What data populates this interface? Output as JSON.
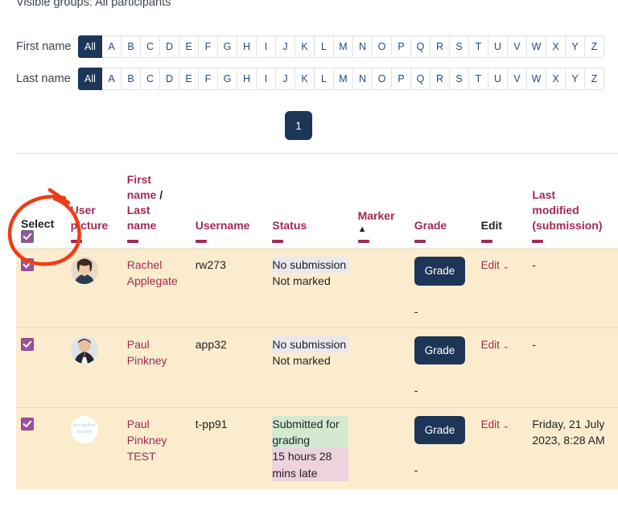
{
  "notice": {
    "visible_groups": "Visible groups: All participants"
  },
  "filters": {
    "first_name": {
      "label": "First name",
      "all": "All",
      "letters": [
        "A",
        "B",
        "C",
        "D",
        "E",
        "F",
        "G",
        "H",
        "I",
        "J",
        "K",
        "L",
        "M",
        "N",
        "O",
        "P",
        "Q",
        "R",
        "S",
        "T",
        "U",
        "V",
        "W",
        "X",
        "Y",
        "Z"
      ]
    },
    "last_name": {
      "label": "Last name",
      "all": "All",
      "letters": [
        "A",
        "B",
        "C",
        "D",
        "E",
        "F",
        "G",
        "H",
        "I",
        "J",
        "K",
        "L",
        "M",
        "N",
        "O",
        "P",
        "Q",
        "R",
        "S",
        "T",
        "U",
        "V",
        "W",
        "X",
        "Y",
        "Z"
      ]
    }
  },
  "paging": {
    "current_page": "1"
  },
  "table": {
    "headers": {
      "select": "Select",
      "user_picture": "User picture",
      "first_last_name_1": "First",
      "first_last_name_2": "name",
      "first_last_name_slash": "/",
      "first_last_name_3": "Last",
      "first_last_name_4": "name",
      "username": "Username",
      "status": "Status",
      "marker": "Marker",
      "marker_sort": "▲",
      "grade": "Grade",
      "edit": "Edit",
      "last_modified_1": "Last",
      "last_modified_2": "modified",
      "last_modified_3": "(submission)"
    },
    "rows": [
      {
        "selected": true,
        "avatar_type": "photo-female",
        "avatar_text": "",
        "first_name": "Rachel",
        "last_name": "Applegate",
        "extra_name": "",
        "username": "rw273",
        "status_main": "No submission",
        "status_main_style": "st-nosub",
        "status_sub": "Not marked",
        "status_sub_style": "",
        "status_extra": "",
        "status_extra_style": "",
        "marker": "",
        "grade_button": "Grade",
        "grade_value": "-",
        "edit_label": "Edit",
        "edit_caret": "⌄",
        "last_modified": "-"
      },
      {
        "selected": true,
        "avatar_type": "photo-male",
        "avatar_text": "",
        "first_name": "Paul",
        "last_name": "Pinkney",
        "extra_name": "",
        "username": "app32",
        "status_main": "No submission",
        "status_main_style": "st-nosub",
        "status_sub": "Not marked",
        "status_sub_style": "",
        "status_extra": "",
        "status_extra_style": "",
        "marker": "",
        "grade_button": "Grade",
        "grade_value": "-",
        "edit_label": "Edit",
        "edit_caret": "⌄",
        "last_modified": "-"
      },
      {
        "selected": true,
        "avatar_type": "test-account",
        "avatar_text": "test student account",
        "first_name": "Paul",
        "last_name": "Pinkney",
        "extra_name": "TEST",
        "username": "t-pp91",
        "status_main": "Submitted for grading",
        "status_main_style": "st-green",
        "status_sub": "15 hours 28 mins late",
        "status_sub_style": "st-pink",
        "status_extra": "",
        "status_extra_style": "",
        "marker": "",
        "grade_button": "Grade",
        "grade_value": "-",
        "edit_label": "Edit",
        "edit_caret": "⌄",
        "last_modified": "Friday, 21 July 2023, 8:28 AM"
      }
    ]
  },
  "annotation": {
    "shape": "red-circle-around-select-header",
    "color": "#f03c16"
  },
  "colors": {
    "navy": "#1d3557",
    "maroon": "#a12b52",
    "row_bg": "#fbeccd",
    "checkbox_purple": "#9e509c",
    "status_green": "#d4e9d2",
    "status_pink": "#eed2dd",
    "status_gray": "#e8e8ee"
  }
}
